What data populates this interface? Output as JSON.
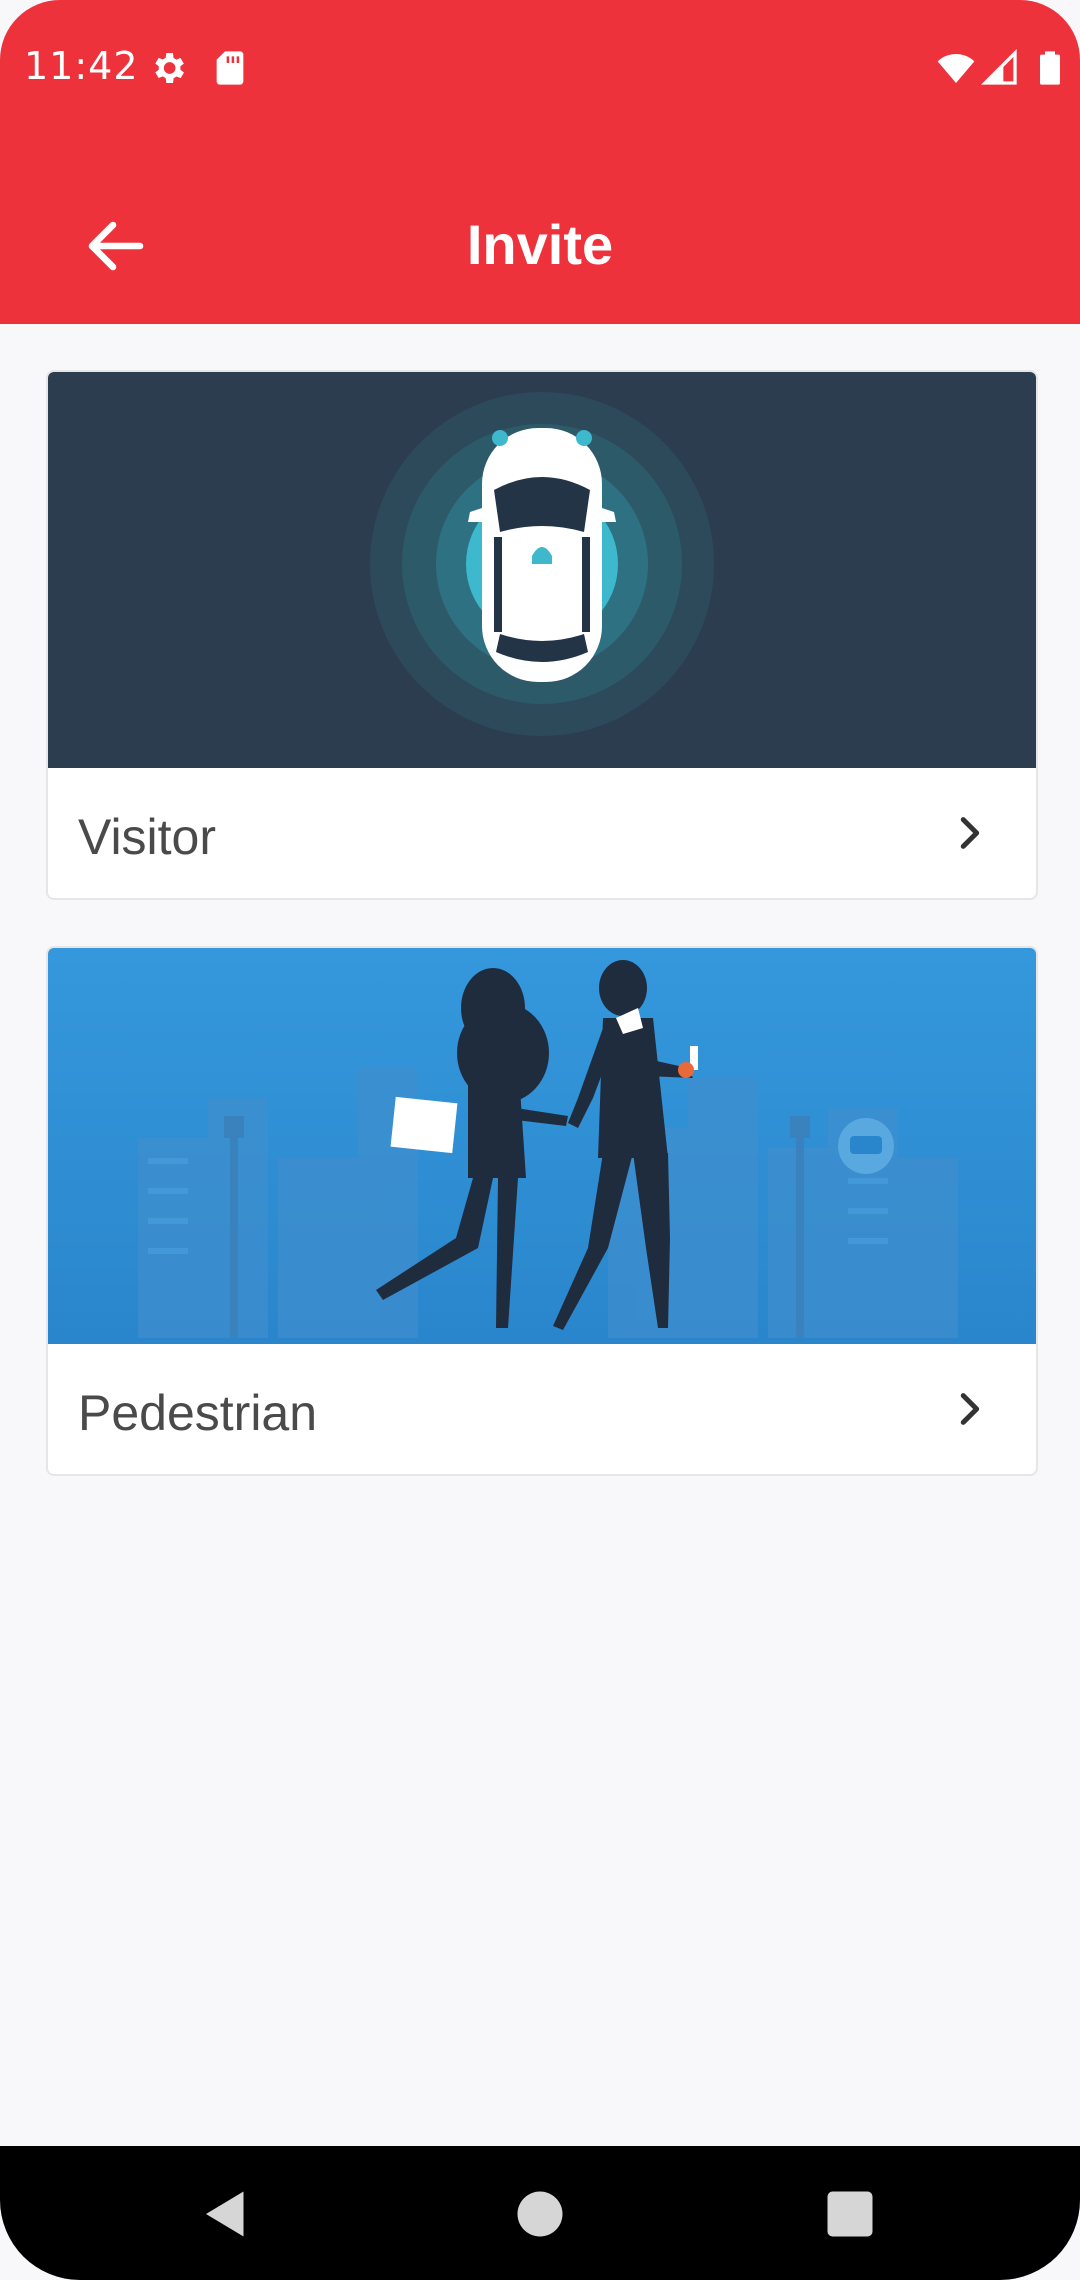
{
  "status_bar": {
    "time": "11:42",
    "icons": [
      "gear-icon",
      "sd-card-icon",
      "wifi-icon",
      "signal-icon",
      "battery-icon"
    ]
  },
  "app_bar": {
    "title": "Invite",
    "back_icon": "arrow-left-icon"
  },
  "cards": [
    {
      "label": "Visitor",
      "image": "car-top-view-illustration",
      "chevron": "chevron-right-icon"
    },
    {
      "label": "Pedestrian",
      "image": "couple-walking-city-illustration",
      "chevron": "chevron-right-icon"
    }
  ],
  "nav_bar": {
    "buttons": [
      "back-triangle-icon",
      "home-circle-icon",
      "recents-square-icon"
    ]
  },
  "colors": {
    "accent": "#ee323c",
    "card_dark": "#2c3d50",
    "card_blue": "#2d8fd6"
  }
}
